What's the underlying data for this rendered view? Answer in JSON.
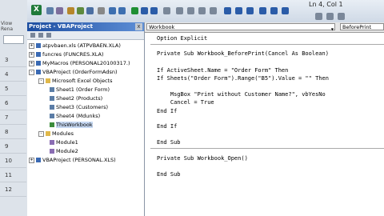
{
  "toolbar": {
    "cursor_position": "Ln 4, Col 1"
  },
  "excel_strip": {
    "view_label": "Viow\nRena",
    "row_numbers": [
      "3",
      "4",
      "5",
      "6",
      "7",
      "8",
      "9",
      "10",
      "11",
      "12"
    ]
  },
  "project_panel": {
    "title": "Project - VBAProject",
    "close": "x",
    "nodes": [
      {
        "label": "atpvbaen.xls (ATPVBAEN.XLA)",
        "expander": "+"
      },
      {
        "label": "funcres (FUNCRES.XLA)",
        "expander": "+"
      },
      {
        "label": "MyMacros (PERSONAL20100317.)",
        "expander": "+"
      },
      {
        "label": "VBAProject (OrderFormAdsn)",
        "expander": "-"
      },
      {
        "label": "Microsoft Excel Objects",
        "expander": "-"
      },
      {
        "label": "Sheet1 (Order Form)"
      },
      {
        "label": "Sheet2 (Products)"
      },
      {
        "label": "Sheet3 (Customers)"
      },
      {
        "label": "Sheet4 (Mdunks)"
      },
      {
        "label": "ThisWorkbook"
      },
      {
        "label": "Modules",
        "expander": "-"
      },
      {
        "label": "Module1"
      },
      {
        "label": "Module2"
      },
      {
        "label": "VBAProject (PERSONAL.XLS)",
        "expander": "+"
      }
    ]
  },
  "code_window": {
    "object_combo": "Workbook",
    "procedure_combo": "BeforePrint",
    "lines": [
      "Option Explicit",
      "Private Sub Workbook_BeforePrint(Cancel As Boolean)",
      "If ActiveSheet.Name = \"Order Form\" Then",
      "If Sheets(\"Order Form\").Range(\"B5\").Value = \"\" Then",
      "    MsgBox \"Print without Customer Name?\", vbYesNo",
      "    Cancel = True",
      "End If",
      "End If",
      "End Sub",
      "Private Sub Workbook_Open()",
      "End Sub"
    ]
  },
  "colors": {
    "title_bar": "#1c4da0",
    "keyword": "#00007f",
    "selection": "#c6d8f2"
  }
}
